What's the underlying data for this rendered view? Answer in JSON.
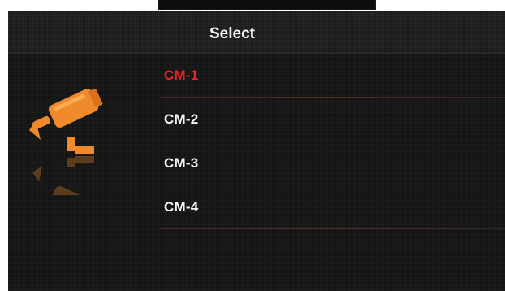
{
  "window": {
    "title": "Select"
  },
  "menu": {
    "items": [
      {
        "label": "CM-1",
        "selected": true
      },
      {
        "label": "CM-2",
        "selected": false
      },
      {
        "label": "CM-3",
        "selected": false
      },
      {
        "label": "CM-4",
        "selected": false
      }
    ]
  },
  "icons": {
    "camera": "security-camera-icon"
  },
  "colors": {
    "selected_text": "#e8232a",
    "normal_text": "#f4f4f4",
    "accent_icon": "#f08a2c",
    "background": "#141414",
    "divider": "#4a3126"
  }
}
